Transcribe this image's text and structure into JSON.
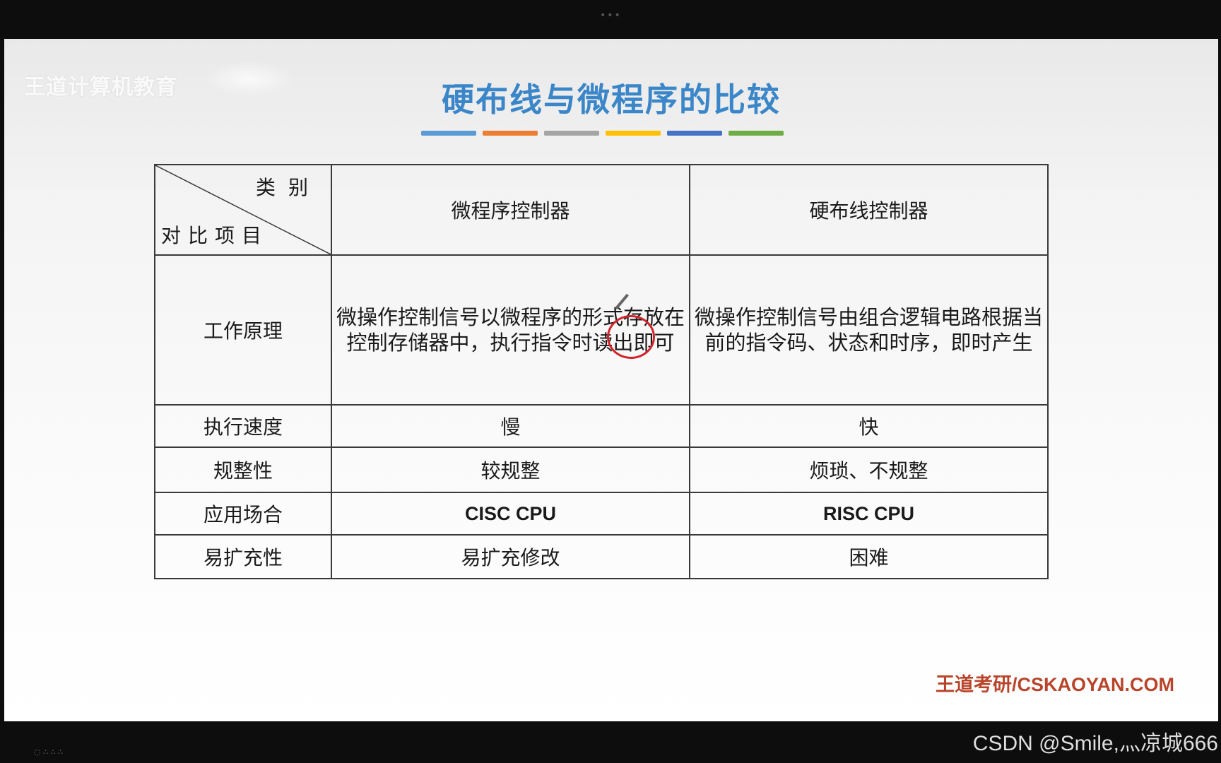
{
  "top_indicator": "•••",
  "slide": {
    "watermark": "王道计算机教育",
    "title": "硬布线与微程序的比较",
    "color_bars": [
      "#5b9bd5",
      "#ed7d31",
      "#a5a5a5",
      "#ffc000",
      "#4472c4",
      "#70ad47"
    ],
    "footer_brand": "王道考研/CSKAOYAN.COM"
  },
  "table": {
    "header": {
      "diag_top": "类别",
      "diag_bottom": "对比项目",
      "col1": "微程序控制器",
      "col2": "硬布线控制器"
    },
    "rows": [
      {
        "label": "工作原理",
        "col1": "微操作控制信号以微程序的形式存放在控制存储器中，执行指令时读出即可",
        "col2": "微操作控制信号由组合逻辑电路根据当前的指令码、状态和时序，即时产生"
      },
      {
        "label": "执行速度",
        "col1": "慢",
        "col2": "快"
      },
      {
        "label": "规整性",
        "col1": "较规整",
        "col2": "烦琐、不规整"
      },
      {
        "label": "应用场合",
        "col1": "CISC CPU",
        "col2": "RISC CPU"
      },
      {
        "label": "易扩充性",
        "col1": "易扩充修改",
        "col2": "困难"
      }
    ]
  },
  "overlay": {
    "csdn_watermark": "CSDN @Smile,灬凉城666"
  }
}
